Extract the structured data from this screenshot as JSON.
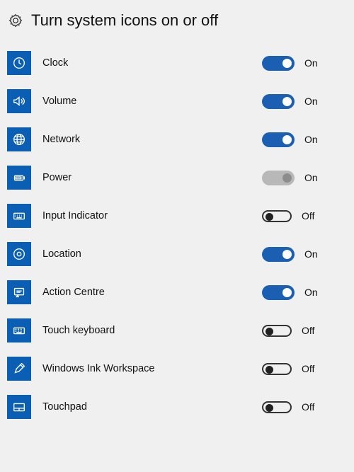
{
  "header": {
    "title": "Turn system icons on or off"
  },
  "labels": {
    "on": "On",
    "off": "Off"
  },
  "colors": {
    "accent": "#1b5fb3"
  },
  "items": [
    {
      "icon": "clock-icon",
      "label": "Clock",
      "state": "on",
      "disabled": false
    },
    {
      "icon": "volume-icon",
      "label": "Volume",
      "state": "on",
      "disabled": false
    },
    {
      "icon": "network-icon",
      "label": "Network",
      "state": "on",
      "disabled": false
    },
    {
      "icon": "power-icon",
      "label": "Power",
      "state": "on",
      "disabled": true
    },
    {
      "icon": "keyboard-icon",
      "label": "Input Indicator",
      "state": "off",
      "disabled": false
    },
    {
      "icon": "location-icon",
      "label": "Location",
      "state": "on",
      "disabled": false
    },
    {
      "icon": "action-centre-icon",
      "label": "Action Centre",
      "state": "on",
      "disabled": false
    },
    {
      "icon": "touch-keyboard-icon",
      "label": "Touch keyboard",
      "state": "off",
      "disabled": false
    },
    {
      "icon": "pen-icon",
      "label": "Windows Ink Workspace",
      "state": "off",
      "disabled": false
    },
    {
      "icon": "touchpad-icon",
      "label": "Touchpad",
      "state": "off",
      "disabled": false
    }
  ]
}
